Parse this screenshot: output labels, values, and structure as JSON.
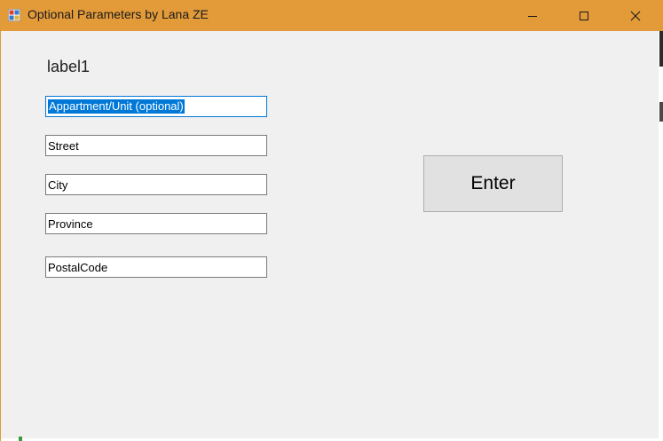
{
  "window": {
    "title": "Optional Parameters by Lana ZE",
    "controls": {
      "minimize": "minimize-icon",
      "maximize": "maximize-icon",
      "close": "close-icon"
    },
    "titlebar_color": "#e39b3a"
  },
  "form": {
    "label": "label1",
    "fields": {
      "apartment": "Appartment/Unit (optional)",
      "street": "Street",
      "city": "City",
      "province": "Province",
      "postal_code": "PostalCode"
    },
    "enter_label": "Enter"
  }
}
